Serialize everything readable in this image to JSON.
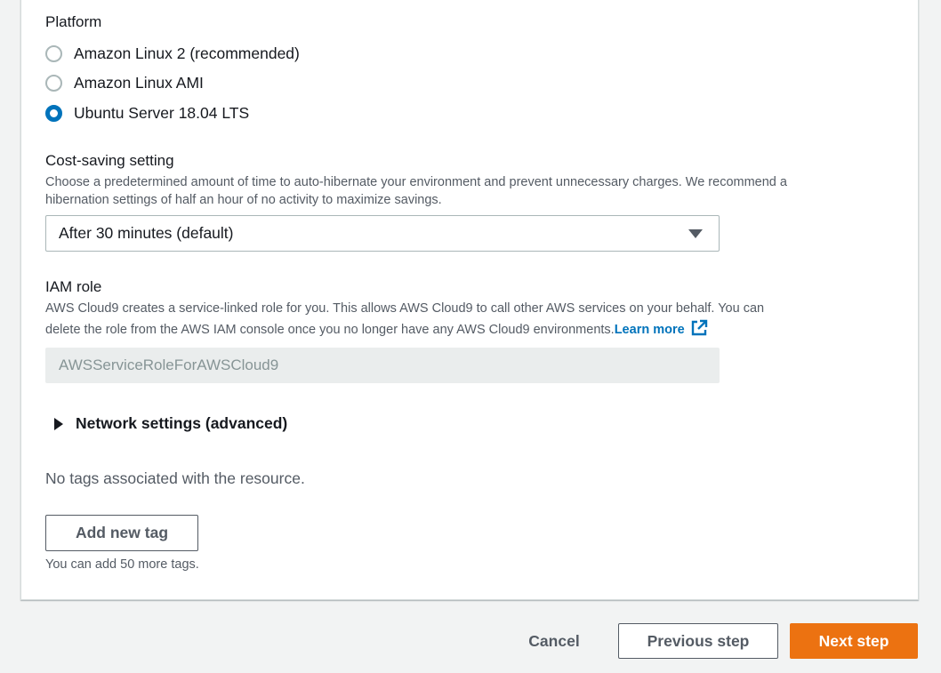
{
  "platform": {
    "label": "Platform",
    "options": [
      {
        "label": "Amazon Linux 2 (recommended)",
        "selected": false
      },
      {
        "label": "Amazon Linux AMI",
        "selected": false
      },
      {
        "label": "Ubuntu Server 18.04 LTS",
        "selected": true
      }
    ]
  },
  "cost_saving": {
    "label": "Cost-saving setting",
    "description_line1": "Choose a predetermined amount of time to auto-hibernate your environment and prevent unnecessary charges. We recommend a",
    "description_line2": "hibernation settings of half an hour of no activity to maximize savings.",
    "selected_value": "After 30 minutes (default)"
  },
  "iam_role": {
    "label": "IAM role",
    "description_line1": "AWS Cloud9 creates a service-linked role for you. This allows AWS Cloud9 to call other AWS services on your behalf. You can",
    "description_line2": "delete the role from the AWS IAM console once you no longer have any AWS Cloud9 environments.",
    "learn_more": "Learn more",
    "value": "AWSServiceRoleForAWSCloud9"
  },
  "network_settings": {
    "label": "Network settings (advanced)",
    "expanded": false
  },
  "tags": {
    "empty_text": "No tags associated with the resource.",
    "add_button": "Add new tag",
    "hint": "You can add 50 more tags."
  },
  "footer": {
    "cancel": "Cancel",
    "previous": "Previous step",
    "next": "Next step"
  },
  "colors": {
    "accent": "#0073bb",
    "primary_button": "#ec7211",
    "background": "#f2f3f3"
  },
  "icons": {
    "external_link": "external-link-icon",
    "expand": "caret-right-icon",
    "dropdown": "caret-down-icon"
  }
}
